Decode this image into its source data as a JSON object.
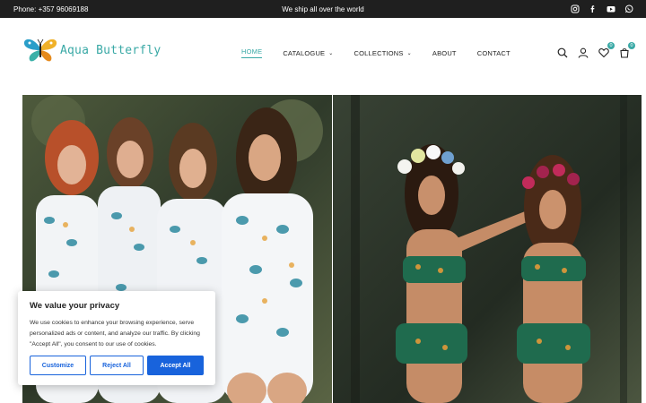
{
  "topbar": {
    "phone": "Phone: +357 96069188",
    "shipping": "We ship all over the world",
    "socials": [
      "instagram-icon",
      "facebook-icon",
      "youtube-icon",
      "whatsapp-icon"
    ]
  },
  "brand": {
    "name": "Aqua Butterfly"
  },
  "nav": {
    "items": [
      {
        "label": "HOME",
        "active": true,
        "dropdown": false
      },
      {
        "label": "CATALOGUE",
        "active": false,
        "dropdown": true
      },
      {
        "label": "COLLECTIONS",
        "active": false,
        "dropdown": true
      },
      {
        "label": "ABOUT",
        "active": false,
        "dropdown": false
      },
      {
        "label": "CONTACT",
        "active": false,
        "dropdown": false
      }
    ]
  },
  "header_icons": {
    "wishlist_count": "0",
    "cart_count": "0"
  },
  "cookie": {
    "title": "We value your privacy",
    "body": "We use cookies to enhance your browsing experience, serve personalized ads or content, and analyze our traffic. By clicking \"Accept All\", you consent to our use of cookies.",
    "customize": "Customize",
    "reject": "Reject All",
    "accept": "Accept All"
  },
  "colors": {
    "accent": "#3aa9a6",
    "cookie_button": "#1863dc",
    "topbar": "#1f1f1f"
  }
}
